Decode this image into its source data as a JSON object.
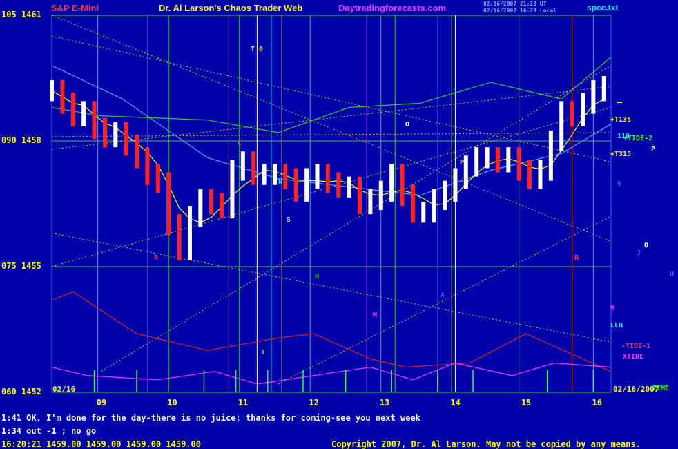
{
  "header": {
    "symbol": "S&P E-Mini",
    "title": "Dr. Al Larson's Chaos Trader Web",
    "site": "Daytradingforecasts.com",
    "file": "spcc.txt",
    "timestamp_top": "02/16/2007 21:23 UT",
    "timestamp_top2": "02/16/2007 16:23 Local",
    "colors": {
      "symbol": "#ff3333",
      "title": "#ffff00",
      "site": "#ff33ff",
      "file": "#00ffff"
    }
  },
  "footer": {
    "line1": "1:41 OK, I'm done for the day-there is no juice; thanks for coming-see you next week",
    "line2": "1:34 out -1 ; no go",
    "quote": "16:20:21  1459.00 1459.00 1459.00 1459.00",
    "copyright": "Copyright 2007, Dr. Al Larson. May not be copied by any means."
  },
  "date_left": "02/16",
  "date_right": "02/16/2007",
  "right_labels": {
    "t135": "+T135",
    "tide2": "+TIDE-2",
    "t315": "+T315",
    "p": "P",
    "v": "V",
    "o": "O",
    "j": "J",
    "u": "U",
    "m": "M",
    "llb": "LLB",
    "tide1": "-TIDE-1",
    "xtide": "XTIDE",
    "time": "TIME",
    "num": "110"
  },
  "annotations": {
    "t0": "T 0",
    "r1": "R",
    "r2": "R",
    "c": "C",
    "n": "N",
    "s": "S",
    "h": "H",
    "m": "M",
    "o": "O",
    "p": "P",
    "a": "A",
    "i": "I"
  },
  "chart_data": {
    "type": "candlestick",
    "x_ticks": [
      "09",
      "10",
      "11",
      "12",
      "13",
      "14",
      "15",
      "16"
    ],
    "y_ticks": [
      {
        "label": "105 1461",
        "price": 1461
      },
      {
        "label": "090 1458",
        "price": 1458
      },
      {
        "label": "075 1455",
        "price": 1455
      },
      {
        "label": "060 1452",
        "price": 1452
      }
    ],
    "ylim": [
      1452,
      1461
    ],
    "xlim": [
      8.3,
      16.2
    ],
    "price_close": [
      [
        8.3,
        1459.2
      ],
      [
        8.45,
        1458.9
      ],
      [
        8.6,
        1458.6
      ],
      [
        8.75,
        1458.7
      ],
      [
        8.9,
        1458.3
      ],
      [
        9.05,
        1458.1
      ],
      [
        9.2,
        1458.2
      ],
      [
        9.35,
        1457.9
      ],
      [
        9.5,
        1457.6
      ],
      [
        9.65,
        1457.2
      ],
      [
        9.8,
        1457.0
      ],
      [
        9.95,
        1456.0
      ],
      [
        10.1,
        1455.4
      ],
      [
        10.25,
        1456.2
      ],
      [
        10.4,
        1456.6
      ],
      [
        10.55,
        1456.5
      ],
      [
        10.7,
        1456.4
      ],
      [
        10.85,
        1457.3
      ],
      [
        11.0,
        1457.5
      ],
      [
        11.15,
        1457.2
      ],
      [
        11.3,
        1457.2
      ],
      [
        11.45,
        1457.2
      ],
      [
        11.6,
        1457.1
      ],
      [
        11.75,
        1456.8
      ],
      [
        11.9,
        1457.1
      ],
      [
        12.05,
        1457.2
      ],
      [
        12.2,
        1457.0
      ],
      [
        12.35,
        1456.9
      ],
      [
        12.5,
        1456.9
      ],
      [
        12.65,
        1456.5
      ],
      [
        12.8,
        1456.6
      ],
      [
        12.95,
        1456.8
      ],
      [
        13.1,
        1457.2
      ],
      [
        13.25,
        1456.7
      ],
      [
        13.4,
        1456.3
      ],
      [
        13.55,
        1456.3
      ],
      [
        13.7,
        1456.6
      ],
      [
        13.85,
        1456.8
      ],
      [
        14.0,
        1457.1
      ],
      [
        14.15,
        1457.4
      ],
      [
        14.3,
        1457.6
      ],
      [
        14.45,
        1457.6
      ],
      [
        14.6,
        1457.5
      ],
      [
        14.75,
        1457.6
      ],
      [
        14.9,
        1457.3
      ],
      [
        15.05,
        1457.1
      ],
      [
        15.2,
        1457.3
      ],
      [
        15.35,
        1458.0
      ],
      [
        15.5,
        1458.7
      ],
      [
        15.65,
        1458.6
      ],
      [
        15.8,
        1458.9
      ],
      [
        15.95,
        1459.2
      ],
      [
        16.1,
        1459.3
      ]
    ],
    "lines": [
      {
        "name": "LLB",
        "color": "#44aaff",
        "points": [
          [
            8.3,
            1459.8
          ],
          [
            9.3,
            1459.0
          ],
          [
            10.5,
            1457.6
          ],
          [
            11.5,
            1457.1
          ],
          [
            12.5,
            1456.9
          ],
          [
            13.5,
            1456.7
          ],
          [
            14.5,
            1457.3
          ],
          [
            15.5,
            1457.7
          ],
          [
            16.2,
            1458.4
          ]
        ]
      },
      {
        "name": "green band",
        "color": "#33cc33",
        "points": [
          [
            8.3,
            1458.8
          ],
          [
            9.0,
            1458.6
          ],
          [
            10.5,
            1458.5
          ],
          [
            11.5,
            1458.2
          ],
          [
            12.5,
            1458.8
          ],
          [
            13.5,
            1458.9
          ],
          [
            14.5,
            1459.4
          ],
          [
            15.5,
            1459.0
          ],
          [
            16.2,
            1460.0
          ]
        ]
      },
      {
        "name": "red band",
        "color": "#dd2222",
        "points": [
          [
            8.3,
            1454.2
          ],
          [
            8.6,
            1454.4
          ],
          [
            9.5,
            1453.4
          ],
          [
            10.5,
            1453.0
          ],
          [
            11.5,
            1453.3
          ],
          [
            12.0,
            1453.4
          ],
          [
            12.8,
            1452.8
          ],
          [
            13.3,
            1452.6
          ],
          [
            14.2,
            1452.7
          ],
          [
            15.0,
            1453.4
          ],
          [
            16.2,
            1452.5
          ]
        ]
      },
      {
        "name": "XTIDE",
        "color": "#ff33ff",
        "points": [
          [
            8.3,
            1452.6
          ],
          [
            8.8,
            1452.4
          ],
          [
            9.8,
            1452.3
          ],
          [
            10.6,
            1452.5
          ],
          [
            11.2,
            1452.2
          ],
          [
            12.0,
            1452.4
          ],
          [
            12.8,
            1452.6
          ],
          [
            13.4,
            1452.3
          ],
          [
            14.0,
            1452.7
          ],
          [
            14.8,
            1452.4
          ],
          [
            15.4,
            1452.7
          ],
          [
            16.2,
            1452.6
          ]
        ]
      }
    ],
    "vertical_lines": [
      {
        "x": 8.95,
        "color": "#33cc33"
      },
      {
        "x": 9.65,
        "color": "#dd2222"
      },
      {
        "x": 9.95,
        "color": "#33cc33"
      },
      {
        "x": 10.8,
        "color": "#dd2222"
      },
      {
        "x": 10.95,
        "color": "#33cc33"
      },
      {
        "x": 11.2,
        "color": "#ffffff"
      },
      {
        "x": 11.4,
        "color": "#00ffff"
      },
      {
        "x": 11.55,
        "color": "#ffffff"
      },
      {
        "x": 11.95,
        "color": "#33cc33"
      },
      {
        "x": 12.75,
        "color": "#ff33ff"
      },
      {
        "x": 12.95,
        "color": "#33cc33"
      },
      {
        "x": 13.15,
        "color": "#33cc33"
      },
      {
        "x": 13.75,
        "color": "#4444ff"
      },
      {
        "x": 13.95,
        "color": "#ffffff"
      },
      {
        "x": 14.0,
        "color": "#ffffff"
      },
      {
        "x": 14.9,
        "color": "#33cc33"
      },
      {
        "x": 15.65,
        "color": "#dd2222"
      },
      {
        "x": 15.95,
        "color": "#33cc33"
      }
    ]
  }
}
